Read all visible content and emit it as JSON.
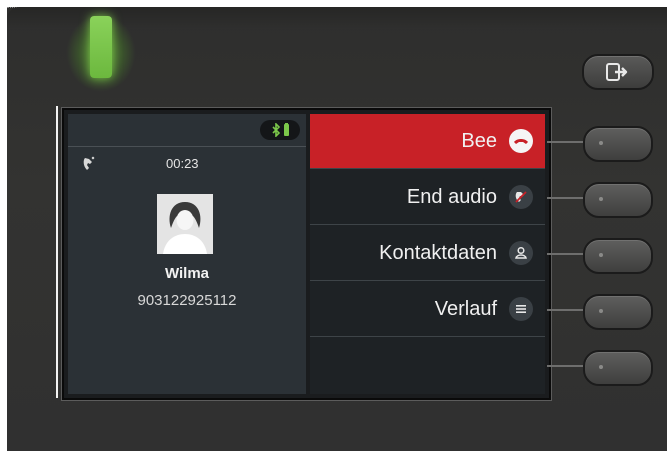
{
  "colors": {
    "accent": "#c82127",
    "led": "#7cc84a",
    "display_bg": "#2b3136",
    "menu_bg": "#1e2225"
  },
  "call": {
    "timer": "00:23",
    "caller_name": "Wilma",
    "caller_number": "903122925112",
    "status_icon": "handset-icon",
    "indicator_icons": [
      "bluetooth-icon",
      "battery-icon"
    ]
  },
  "menu": {
    "items": [
      {
        "label": "Bee",
        "icon": "hang-up-icon",
        "active": true
      },
      {
        "label": "End audio",
        "icon": "end-audio-icon",
        "active": false
      },
      {
        "label": "Kontaktdaten",
        "icon": "contact-icon",
        "active": false
      },
      {
        "label": "Verlauf",
        "icon": "list-icon",
        "active": false
      },
      {
        "label": "",
        "icon": "",
        "active": false
      }
    ]
  },
  "hardware": {
    "logout_key_icon": "logout-icon",
    "softkeys": 5
  }
}
